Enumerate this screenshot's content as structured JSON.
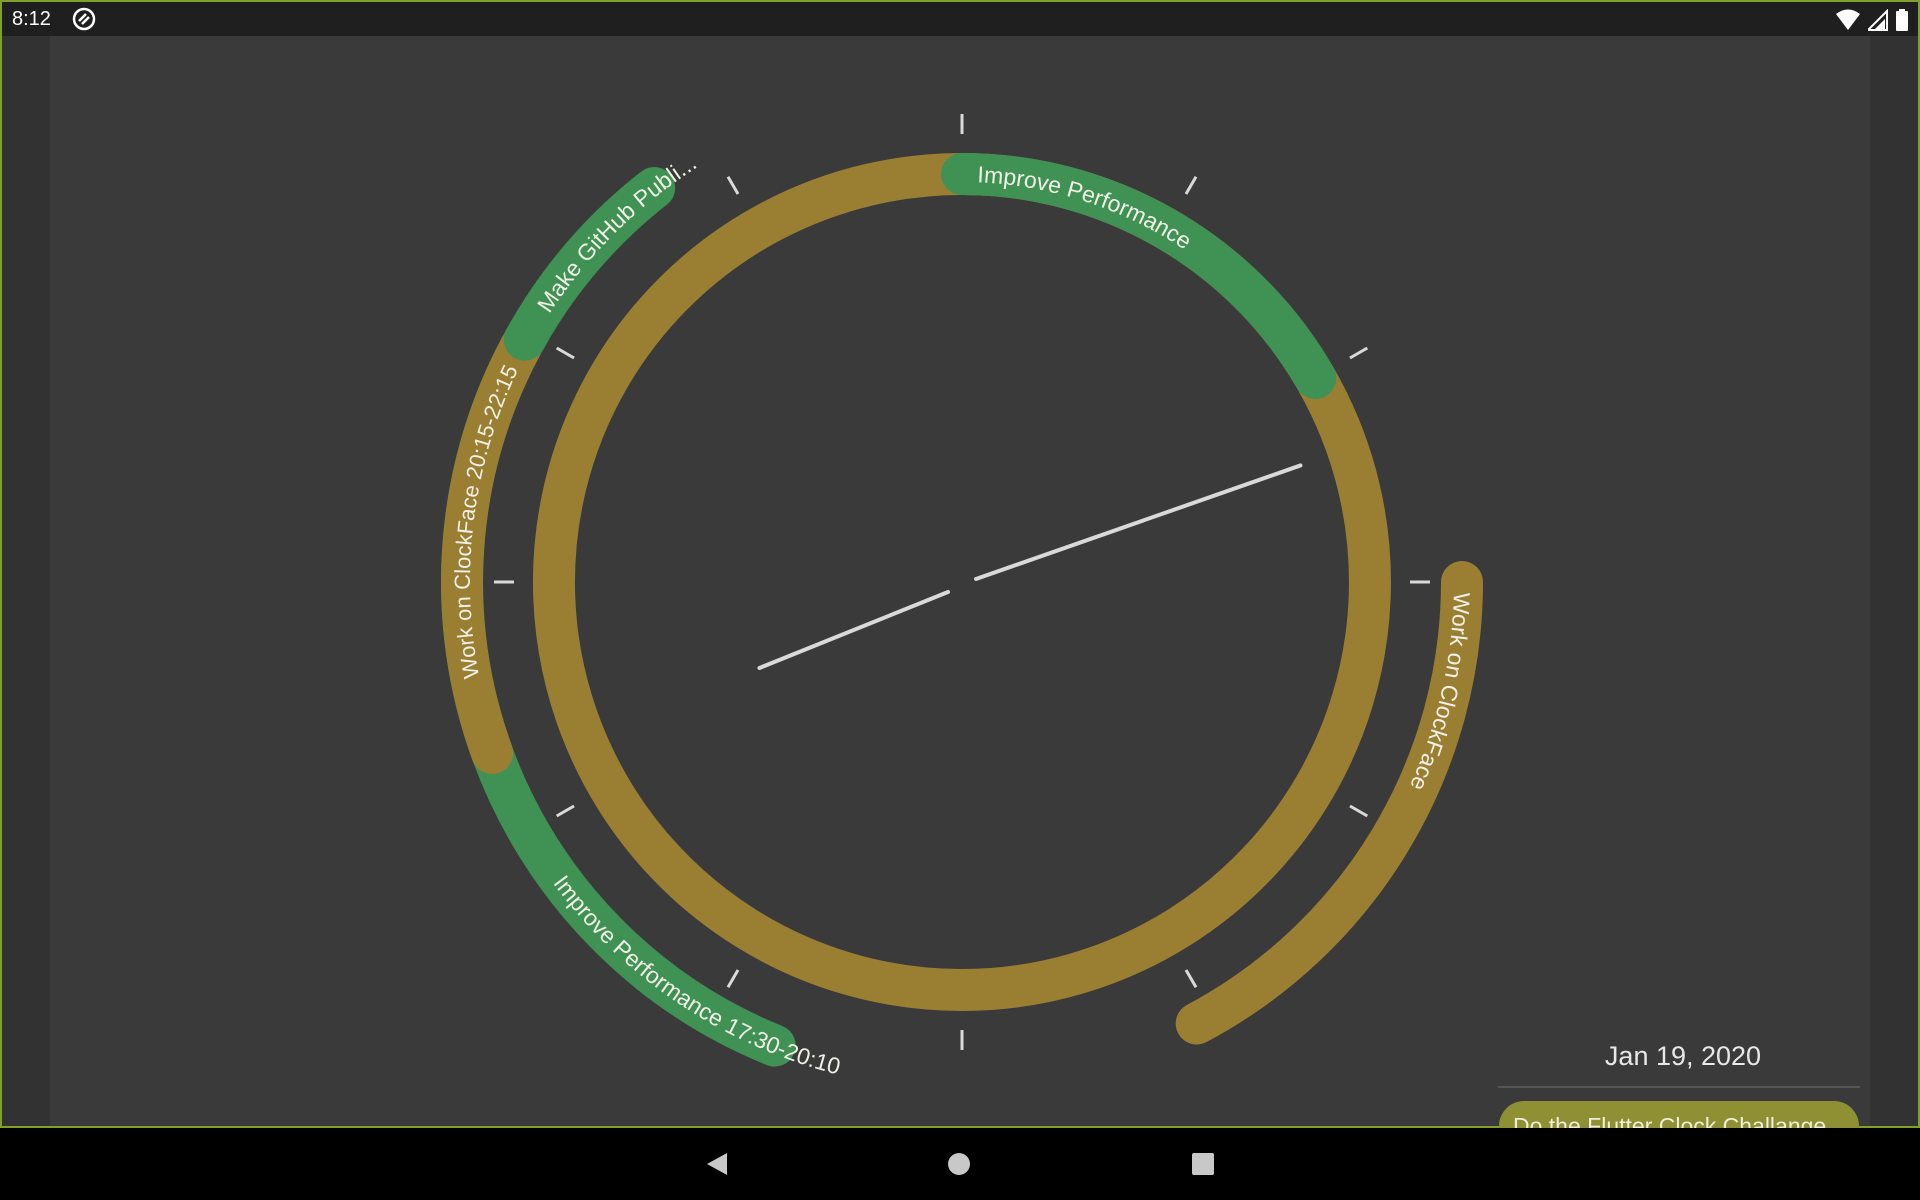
{
  "status_bar": {
    "time": "8:12",
    "icons": [
      "app-notification-icon",
      "wifi-icon",
      "signal-icon",
      "battery-icon"
    ]
  },
  "clock": {
    "colors": {
      "background": "#3a3a3a",
      "green": "#3f9154",
      "gold": "#9a7f33",
      "ticks": "#d9d9d9",
      "label": "#f0f0e6"
    },
    "arc_labels": [
      "Improve Performance",
      "Make GitHub Publi...",
      "Work on ClockFace  20:15-22:15",
      "Improve Performance  17:30-20:10",
      "Work on ClockFace"
    ]
  },
  "agenda": {
    "date": "Jan 19, 2020",
    "task": "Do the Flutter Clock Challange",
    "task_color": "#8f8f33"
  },
  "nav_bar": {
    "buttons": [
      "back-icon",
      "home-icon",
      "recents-icon"
    ]
  }
}
